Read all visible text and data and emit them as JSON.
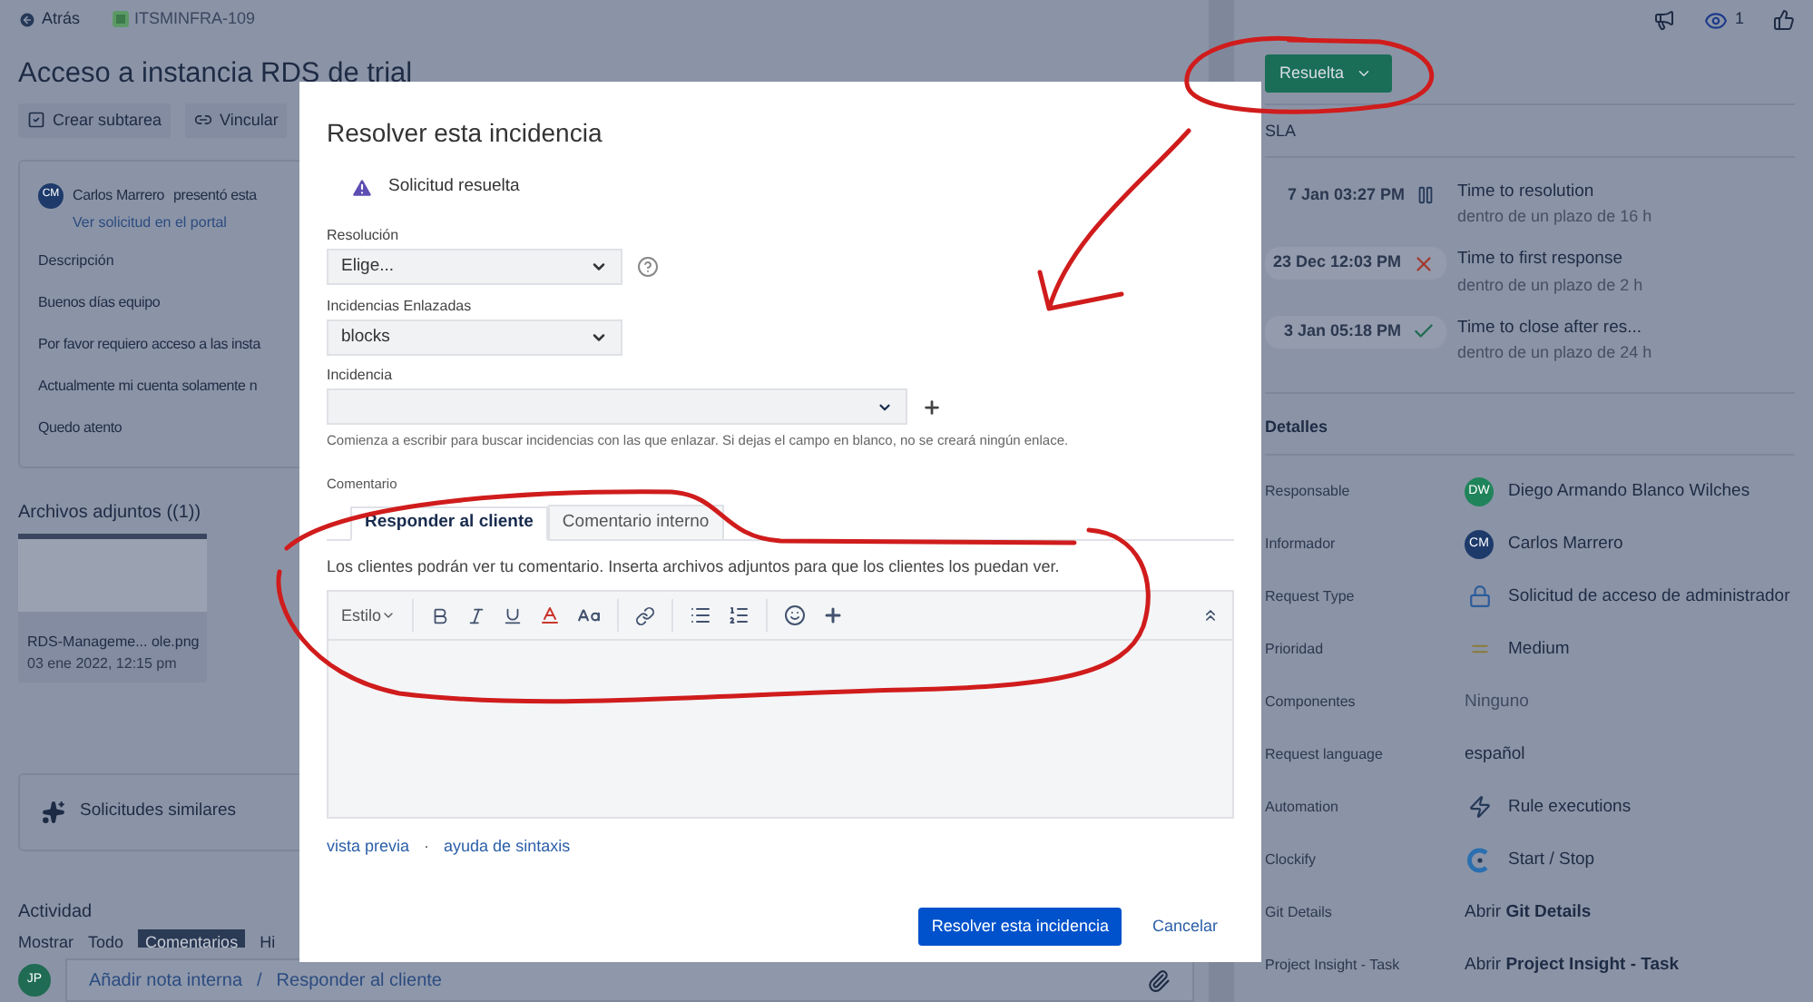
{
  "top_bar": {
    "back": "Atrás",
    "issue_key": "ITSMINFRA-109",
    "watchers": "1"
  },
  "title": "Acceso a instancia RDS de trial",
  "actions": [
    "Crear subtarea",
    "Vincular"
  ],
  "request": {
    "avatar": "CM",
    "author": "Carlos Marrero",
    "action": "presentó esta",
    "portal_link": "Ver solicitud en el portal",
    "description_label": "Descripción",
    "paragraphs": [
      "Buenos días equipo",
      "Por favor requiero acceso a las insta",
      "Actualmente mi cuenta solamente n",
      "Quedo atento"
    ]
  },
  "attachments": {
    "title": "Archivos adjuntos ((1))",
    "file": {
      "name": "RDS-Manageme... ole.png",
      "date": "03 ene 2022, 12:15 pm"
    }
  },
  "similar": "Solicitudes similares",
  "activity": {
    "title": "Actividad",
    "show_label": "Mostrar",
    "filters": [
      {
        "label": "Todo",
        "selected": false
      },
      {
        "label": "Comentarios",
        "selected": true
      },
      {
        "label": "Hi",
        "selected": false
      }
    ]
  },
  "comment_bar": {
    "avatar": "JP",
    "internal": "Añadir nota interna",
    "separator": "/",
    "reply": "Responder al cliente"
  },
  "status_button": "Resuelta",
  "sla": {
    "title": "SLA",
    "items": [
      {
        "date": "7 Jan 03:27 PM",
        "kind": "paused",
        "name": "Time to resolution",
        "goal": "dentro de un plazo de 16 h"
      },
      {
        "date": "23 Dec 12:03 PM",
        "kind": "breached",
        "name": "Time to first response",
        "goal": "dentro de un plazo de 2 h"
      },
      {
        "date": "3 Jan 05:18 PM",
        "kind": "met",
        "name": "Time to close after res...",
        "goal": "dentro de un plazo de 24 h"
      }
    ]
  },
  "details": {
    "title": "Detalles",
    "rows": [
      {
        "label": "Responsable",
        "kind": "avatar",
        "avatar": "DW",
        "color": "#1f845a",
        "value": "Diego Armando Blanco Wilches"
      },
      {
        "label": "Informador",
        "kind": "avatar",
        "avatar": "CM",
        "color": "#1d3a6b",
        "value": "Carlos Marrero"
      },
      {
        "label": "Request Type",
        "kind": "request_type",
        "value": "Solicitud de acceso de administrador"
      },
      {
        "label": "Prioridad",
        "kind": "priority",
        "value": "Medium"
      },
      {
        "label": "Componentes",
        "kind": "muted",
        "value": "Ninguno"
      },
      {
        "label": "Request language",
        "kind": "plain",
        "value": "español"
      },
      {
        "label": "Automation",
        "kind": "automation",
        "value": "Rule executions"
      },
      {
        "label": "Clockify",
        "kind": "clockify",
        "value": "Start / Stop"
      },
      {
        "label": "Git Details",
        "kind": "plain",
        "value": "Abrir **Git Details**"
      },
      {
        "label": "Project Insight - Task",
        "kind": "plain",
        "value": "Abrir **Project Insight - Task**"
      }
    ]
  },
  "modal": {
    "title": "Resolver esta incidencia",
    "status": "Solicitud resuelta",
    "resolution": {
      "label": "Resolución",
      "value": "Elige..."
    },
    "linked": {
      "label": "Incidencias Enlazadas",
      "value": "blocks"
    },
    "issue": {
      "label": "Incidencia",
      "hint": "Comienza a escribir para buscar incidencias con las que enlazar. Si dejas el campo en blanco, no se creará ningún enlace."
    },
    "comment": {
      "label": "Comentario",
      "tabs": [
        {
          "label": "Responder al cliente",
          "selected": true
        },
        {
          "label": "Comentario interno",
          "selected": false
        }
      ],
      "notice": "Los clientes podrán ver tu comentario. Inserta archivos adjuntos para que los clientes los puedan ver.",
      "style": "Estilo",
      "links": [
        "vista previa",
        "ayuda de sintaxis"
      ],
      "separator": "·"
    },
    "submit": "Resolver esta incidencia",
    "cancel": "Cancelar"
  }
}
